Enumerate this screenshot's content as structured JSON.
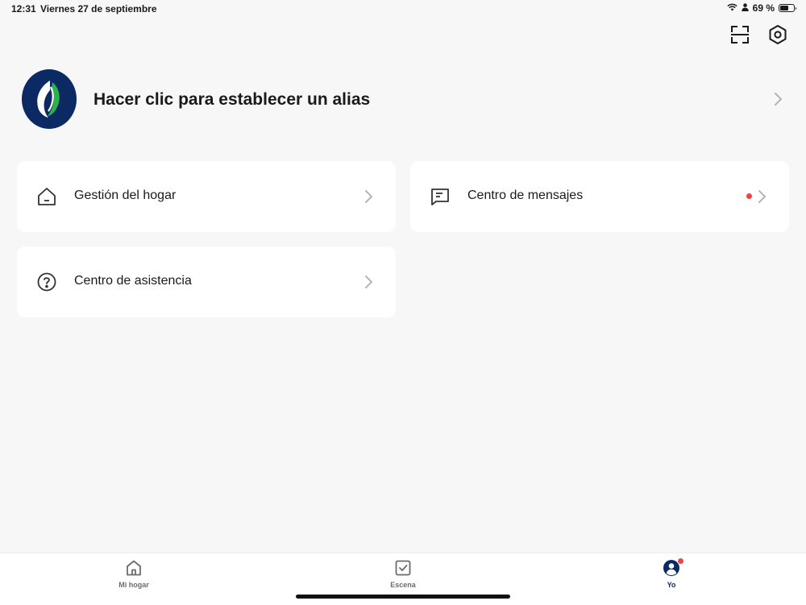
{
  "status_bar": {
    "time": "12:31",
    "date": "Viernes 27 de septiembre",
    "battery": "69 %",
    "battery_level": 0.69
  },
  "top_actions": {
    "scan_icon": "scan-icon",
    "settings_icon": "settings-hexagon-icon"
  },
  "profile": {
    "alias_prompt": "Hacer clic para establecer un alias",
    "avatar_icon": "leaf-logo",
    "avatar_color": "#0b2a63",
    "accent_color": "#2bb34a"
  },
  "cards": {
    "home_management": {
      "label": "Gestión del hogar",
      "icon": "house-icon"
    },
    "message_center": {
      "label": "Centro de mensajes",
      "icon": "message-icon",
      "has_unread": true
    },
    "help_center": {
      "label": "Centro de asistencia",
      "icon": "question-circle-icon"
    }
  },
  "tab_bar": {
    "tabs": [
      {
        "label": "Mi hogar",
        "icon": "house-icon",
        "active": false
      },
      {
        "label": "Escena",
        "icon": "checkbox-icon",
        "active": false
      },
      {
        "label": "Yo",
        "icon": "person-icon",
        "active": true,
        "has_badge": true
      }
    ]
  },
  "colors": {
    "background": "#f7f7f7",
    "card": "#ffffff",
    "active_tab": "#0b2a63",
    "badge": "#ef4444"
  }
}
